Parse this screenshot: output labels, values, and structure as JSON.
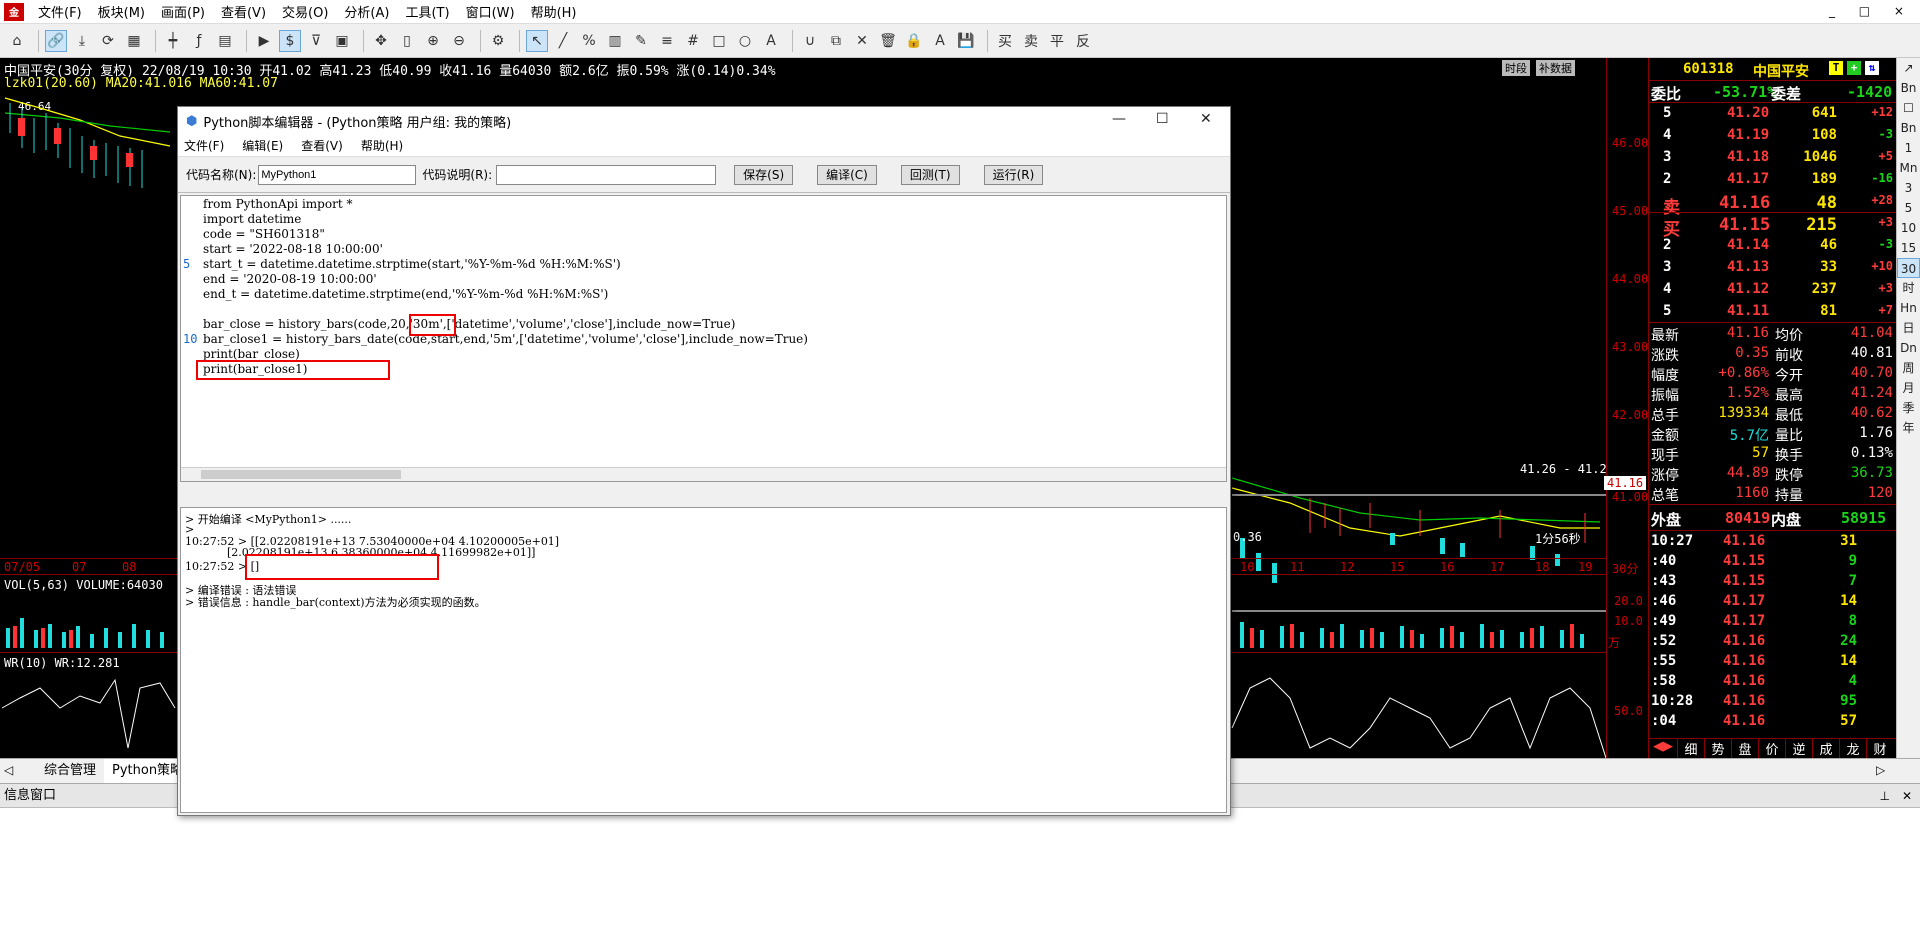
{
  "app": {
    "menu": [
      "文件(F)",
      "板块(M)",
      "画面(P)",
      "查看(V)",
      "交易(O)",
      "分析(A)",
      "工具(T)",
      "窗口(W)",
      "帮助(H)"
    ],
    "winctl": "_ □ ×"
  },
  "chart": {
    "header1": "中国平安(30分  复权) 22/08/19 10:30 开41.02 高41.23 低40.99 收41.16 量64030 额2.6亿 振0.59% 涨(0.14)0.34%",
    "header2": "lzk01(20.60)  MA20:41.016  MA60:41.07",
    "btn_timeframe": "时段",
    "btn_supplement": "补数据",
    "top_price_label": "46.64",
    "y_axis": [
      "46.00",
      "45.00",
      "44.00",
      "43.00",
      "42.00",
      "41.00"
    ],
    "current_price_tag": "41.16",
    "range_label": "41.26 - 41.2",
    "countdown": "1分56秒",
    "low_label": "0.36",
    "date_axis_left": [
      "07/05",
      "07",
      "08"
    ],
    "date_axis_right": [
      "10",
      "11",
      "12",
      "15",
      "16",
      "17",
      "18",
      "19"
    ],
    "period_label": "30分",
    "vol_header": "VOL(5,63)  VOLUME:64030",
    "vol_axis": [
      "20.0",
      "10.0",
      "万"
    ],
    "wr_header": "WR(10)  WR:12.281",
    "wr_axis": "50.0"
  },
  "quote": {
    "code": "601318",
    "name": "中国平安",
    "weibi_label": "委比",
    "weibi_value": "-53.71%",
    "weicha_label": "委差",
    "weicha_value": "-1420",
    "sell": [
      {
        "lvl": "5",
        "price": "41.20",
        "vol": "641",
        "chg": "+12"
      },
      {
        "lvl": "4",
        "price": "41.19",
        "vol": "108",
        "chg": "-3"
      },
      {
        "lvl": "3",
        "price": "41.18",
        "vol": "1046",
        "chg": "+5"
      },
      {
        "lvl": "2",
        "price": "41.17",
        "vol": "189",
        "chg": "-16"
      },
      {
        "lvl": "卖",
        "price": "41.16",
        "vol": "48",
        "chg": "+28"
      }
    ],
    "buy": [
      {
        "lvl": "买",
        "price": "41.15",
        "vol": "215",
        "chg": "+3"
      },
      {
        "lvl": "2",
        "price": "41.14",
        "vol": "46",
        "chg": "-3"
      },
      {
        "lvl": "3",
        "price": "41.13",
        "vol": "33",
        "chg": "+10"
      },
      {
        "lvl": "4",
        "price": "41.12",
        "vol": "237",
        "chg": "+3"
      },
      {
        "lvl": "5",
        "price": "41.11",
        "vol": "81",
        "chg": "+7"
      }
    ],
    "stats": [
      {
        "l1": "最新",
        "v1": "41.16",
        "l2": "均价",
        "v2": "41.04"
      },
      {
        "l1": "涨跌",
        "v1": "0.35",
        "l2": "前收",
        "v2": "40.81"
      },
      {
        "l1": "幅度",
        "v1": "+0.86%",
        "l2": "今开",
        "v2": "40.70"
      },
      {
        "l1": "振幅",
        "v1": "1.52%",
        "l2": "最高",
        "v2": "41.24"
      },
      {
        "l1": "总手",
        "v1": "139334",
        "l2": "最低",
        "v2": "40.62"
      },
      {
        "l1": "金额",
        "v1": "5.7亿",
        "l2": "量比",
        "v2": "1.76"
      },
      {
        "l1": "现手",
        "v1": "57",
        "l2": "换手",
        "v2": "0.13%"
      },
      {
        "l1": "涨停",
        "v1": "44.89",
        "l2": "跌停",
        "v2": "36.73"
      },
      {
        "l1": "总笔",
        "v1": "1160",
        "l2": "持量",
        "v2": "120"
      }
    ],
    "waipan_label": "外盘",
    "waipan_value": "80419",
    "neipan_label": "内盘",
    "neipan_value": "58915",
    "ticks": [
      {
        "t": "10:27",
        "p": "41.16",
        "v": "31"
      },
      {
        "t": ":40",
        "p": "41.15",
        "v": "9"
      },
      {
        "t": ":43",
        "p": "41.15",
        "v": "7"
      },
      {
        "t": ":46",
        "p": "41.17",
        "v": "14"
      },
      {
        "t": ":49",
        "p": "41.17",
        "v": "8"
      },
      {
        "t": ":52",
        "p": "41.16",
        "v": "24"
      },
      {
        "t": ":55",
        "p": "41.16",
        "v": "14"
      },
      {
        "t": ":58",
        "p": "41.16",
        "v": "4"
      },
      {
        "t": "10:28",
        "p": "41.16",
        "v": "95"
      },
      {
        "t": ":04",
        "p": "41.16",
        "v": "57"
      }
    ],
    "bottom_tabs": [
      "细",
      "势",
      "盘",
      "价",
      "逆",
      "成",
      "龙",
      "财"
    ]
  },
  "rside": [
    "↗",
    "Bn",
    "☐",
    "Bn",
    "1",
    "Mn",
    "3",
    "5",
    "10",
    "15",
    "30",
    "时",
    "Hn",
    "日",
    "Dn",
    "周",
    "月",
    "季",
    "年"
  ],
  "tabs": [
    "综合管理",
    "Python策略"
  ],
  "info_window_label": "信息窗口",
  "editor": {
    "title": "Python脚本编辑器 - (Python策略 用户组: 我的策略)",
    "menu": [
      "文件(F)",
      "编辑(E)",
      "查看(V)",
      "帮助(H)"
    ],
    "code_name_label": "代码名称(N):",
    "code_name_value": "MyPython1",
    "code_desc_label": "代码说明(R):",
    "code_desc_value": "",
    "btn_save": "保存(S)",
    "btn_compile": "编译(C)",
    "btn_backtest": "回测(T)",
    "btn_run": "运行(R)",
    "code_lines": [
      "from PythonApi import *",
      "import datetime",
      "code = \"SH601318\"",
      "start = '2022-08-18 10:00:00'",
      "start_t = datetime.datetime.strptime(start,'%Y-%m-%d %H:%M:%S')",
      "end = '2020-08-19 10:00:00'",
      "end_t = datetime.datetime.strptime(end,'%Y-%m-%d %H:%M:%S')",
      "",
      "bar_close = history_bars(code,20,'30m',['datetime','volume','close'],include_now=True)",
      "bar_close1 = history_bars_date(code,start,end,'5m',['datetime','volume','close'],include_now=True)",
      "print(bar_close)",
      "print(bar_close1)"
    ],
    "line_numbers": [
      "5",
      "10"
    ],
    "output_lines": [
      "> 开始编译 <MyPython1> ......",
      ">",
      "10:27:52 > [[2.02208191e+13 7.53040000e+04 4.10200005e+01]",
      "            [2.02208191e+13 6.38360000e+04 4.11699982e+01]]",
      "10:27:52 > []",
      "> 编译错误 : 语法错误",
      "> 错误信息 : handle_bar(context)方法为必须实现的函数。"
    ]
  }
}
